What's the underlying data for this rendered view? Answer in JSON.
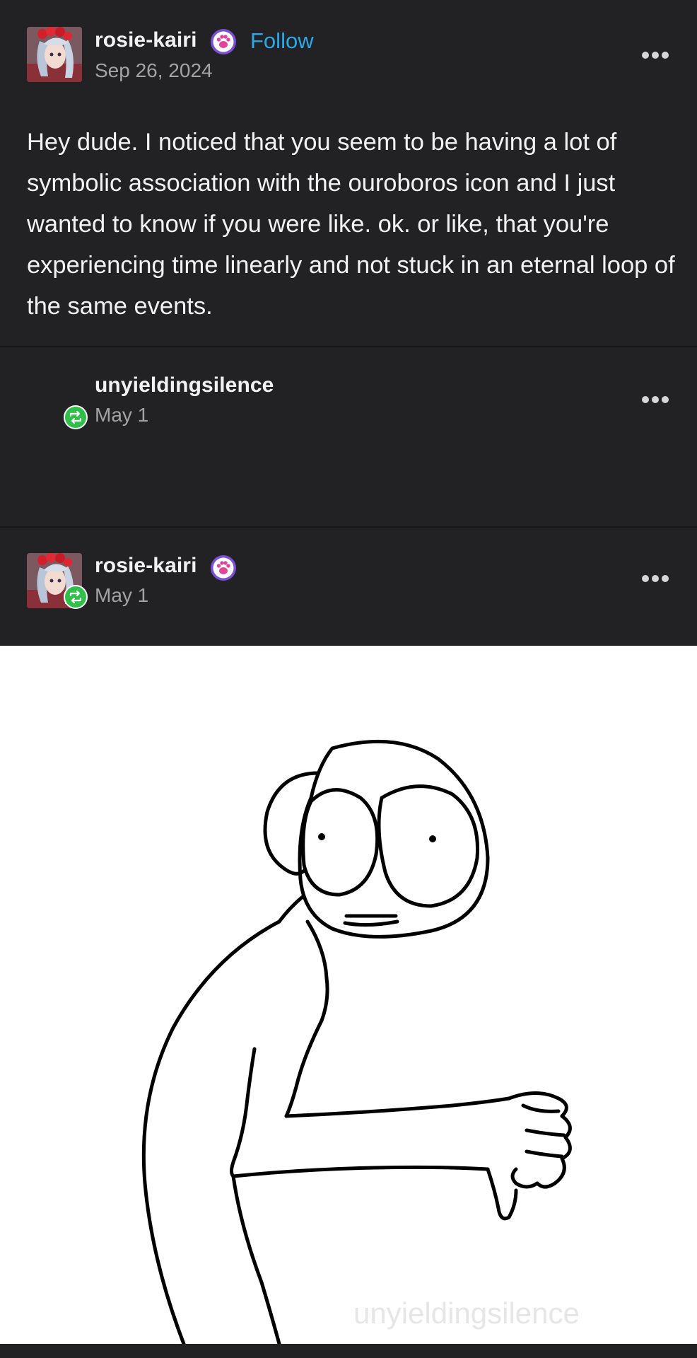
{
  "original_post": {
    "username": "rosie-kairi",
    "follow_label": "Follow",
    "date": "Sep 26, 2024",
    "body": "Hey dude. I noticed that you seem to be having a lot of symbolic association with the ouroboros icon and I just wanted to know if you were like. ok. or like, that you're experiencing time linearly and not stuck in an eternal loop of the same events."
  },
  "reblog_1": {
    "username": "unyieldingsilence",
    "date": "May 1"
  },
  "reblog_2": {
    "username": "rosie-kairi",
    "date": "May 1"
  },
  "image": {
    "watermark": "unyieldingsilence"
  },
  "icons": {
    "paw_badge": "paw-badge-icon",
    "reblog": "reblog-icon",
    "more": "more-options-icon"
  },
  "colors": {
    "background": "#222224",
    "text": "#f2f2f2",
    "muted": "#a3a3a3",
    "follow": "#2ea7e8",
    "badge_purple": "#7b4fd6",
    "reblog_green": "#2fc049"
  }
}
